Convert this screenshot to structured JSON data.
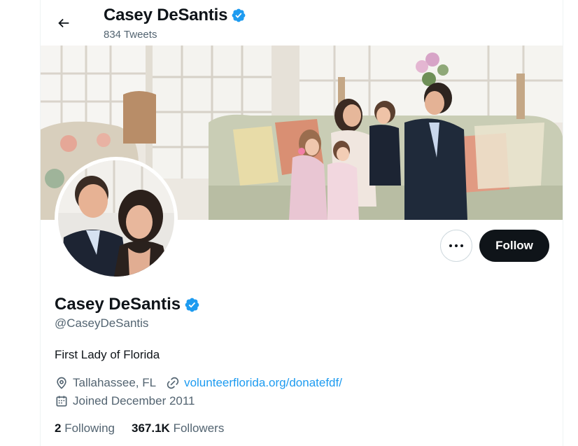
{
  "header": {
    "name": "Casey DeSantis",
    "tweet_count": "834 Tweets"
  },
  "profile": {
    "name": "Casey DeSantis",
    "handle": "@CaseyDeSantis",
    "bio": "First Lady of Florida",
    "location": "Tallahassee, FL",
    "website": "volunteerflorida.org/donatefdf/",
    "joined": "Joined December 2011",
    "following_count": "2",
    "following_label": "Following",
    "followers_count": "367.1K",
    "followers_label": "Followers"
  },
  "actions": {
    "follow_label": "Follow"
  },
  "icons": {
    "back": "arrow-left-icon",
    "verified": "verified-badge-icon",
    "more": "more-dots-icon",
    "location": "location-pin-icon",
    "link": "link-icon",
    "calendar": "calendar-icon"
  },
  "colors": {
    "accent": "#1d9bf0",
    "text": "#0f1419",
    "secondary": "#536471",
    "button_dark": "#0f1419"
  }
}
